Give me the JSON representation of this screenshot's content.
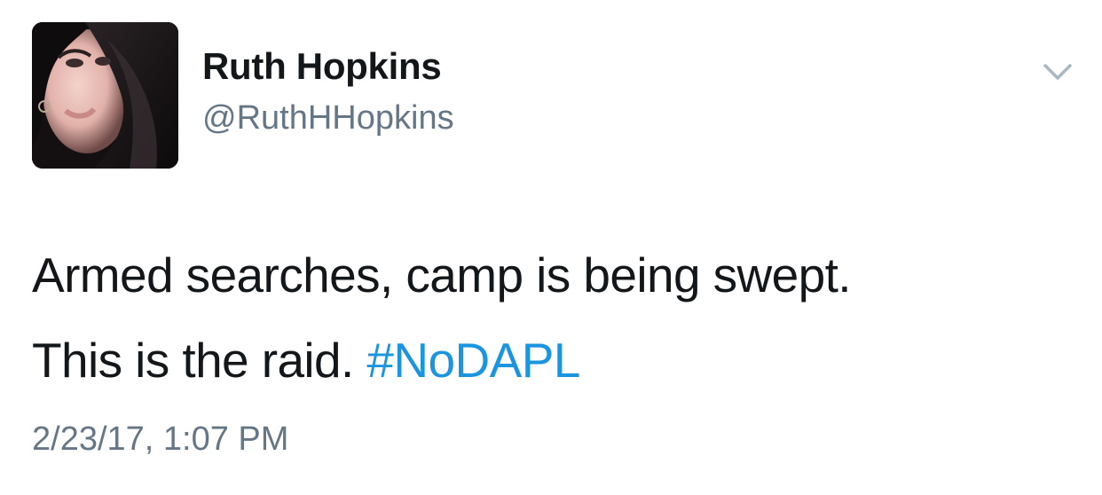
{
  "tweet": {
    "author": {
      "name": "Ruth Hopkins",
      "handle": "@RuthHHopkins"
    },
    "text": {
      "line1": "Armed searches, camp is being swept.",
      "line2_prefix": "This is the raid.",
      "hashtag": "#NoDAPL"
    },
    "timestamp": "2/23/17, 1:07 PM"
  },
  "colors": {
    "text": "#14171a",
    "secondary": "#657786",
    "link": "#1b95e0"
  },
  "icons": {
    "menu": "chevron-down-icon"
  }
}
